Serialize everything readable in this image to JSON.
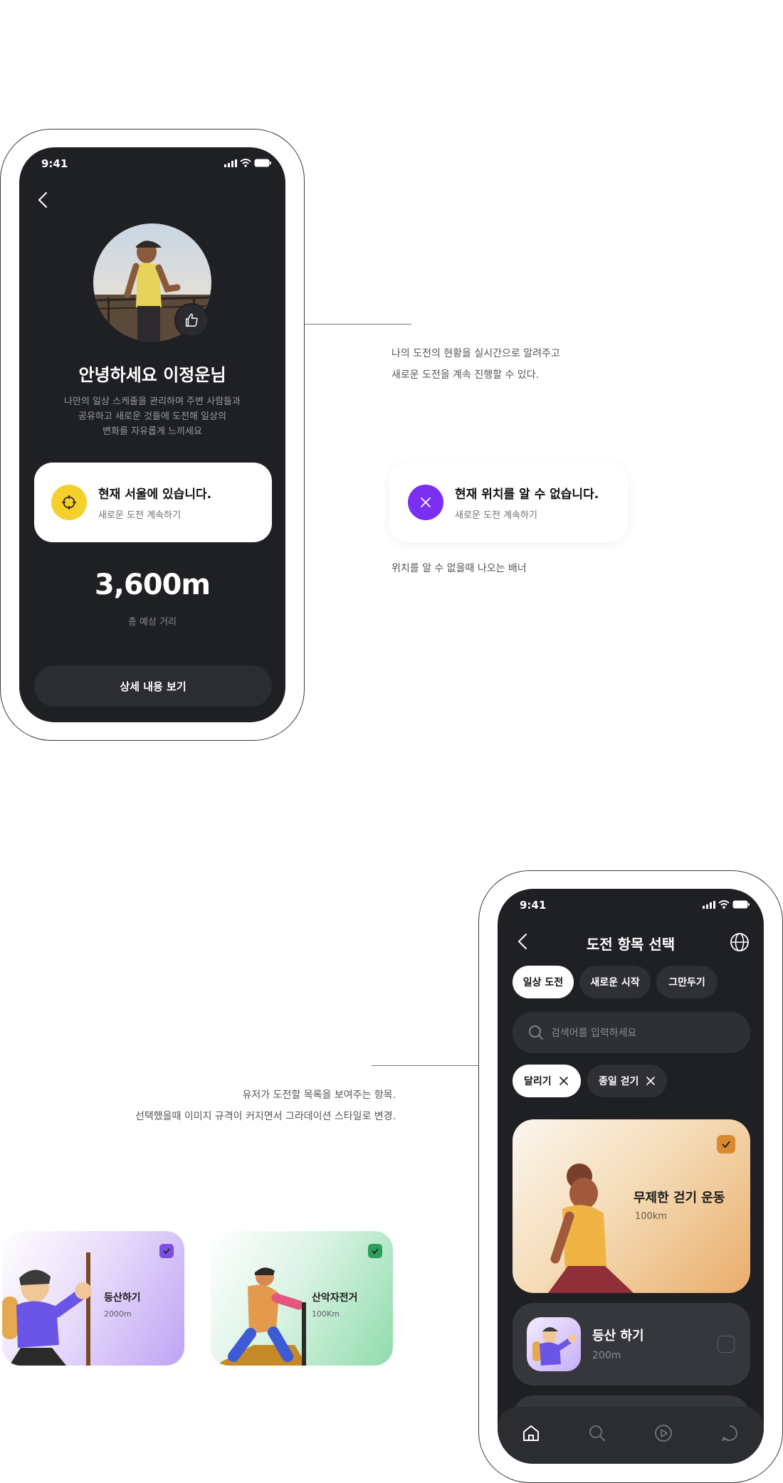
{
  "phone1": {
    "status_time": "9:41",
    "greeting": "안녕하세요 이정운님",
    "description_lines": [
      "나만의 일상 스케줄을 관리하며 주변 사람들과",
      "공유하고 새로운 것들에 도전해 일상의",
      "변화를 자유롭게 느끼세요"
    ],
    "location_card": {
      "title": "현재 서울에 있습니다.",
      "subtitle": "새로운 도전 계속하기",
      "icon": "crosshair-icon",
      "icon_color": "#f5cf2b"
    },
    "distance": "3,600m",
    "distance_label": "총 예상 거리",
    "detail_button": "상세 내용 보기"
  },
  "note1": {
    "lines": [
      "나의 도전의 현황을 실시간으로 알려주고",
      "새로운 도전을 계속 진행할 수 있다."
    ]
  },
  "error_banner": {
    "title": "현재 위치를 알 수 없습니다.",
    "subtitle": "새로운 도전 계속하기",
    "icon": "close-icon",
    "icon_color": "#7b2ff2"
  },
  "note_banner": {
    "text": "위치를 알 수 없을때 나오는 배너"
  },
  "note2": {
    "lines": [
      "유저가 도전할 목록을 보여주는 항목.",
      "선택했을때 이미지 규격이 커지면서 그라데이션 스타일로 변경."
    ]
  },
  "small_cards": [
    {
      "title": "등산하기",
      "subtitle": "2000m",
      "check_color": "#7b4fe0"
    },
    {
      "title": "산악자전거",
      "subtitle": "100Km",
      "check_color": "#2f9e5d"
    }
  ],
  "phone2": {
    "status_time": "9:41",
    "title": "도전 항목 선택",
    "tabs": [
      "일상 도전",
      "새로운 시작",
      "그만두기"
    ],
    "search_placeholder": "검색어를 입력하세요",
    "chips": [
      "달리기",
      "종일 걷기"
    ],
    "featured": {
      "title": "무제한 걷기 운동",
      "subtitle": "100km",
      "check_color": "#d9892f"
    },
    "list_item": {
      "title": "등산 하기",
      "subtitle": "200m"
    },
    "tabbar_icons": [
      "home-icon",
      "search-icon",
      "play-icon",
      "chat-icon"
    ]
  },
  "colors": {
    "screen_bg": "#1f2023",
    "card_dark": "#35373c",
    "accent_yellow": "#f5cf2b",
    "accent_purple": "#7b2ff2"
  }
}
